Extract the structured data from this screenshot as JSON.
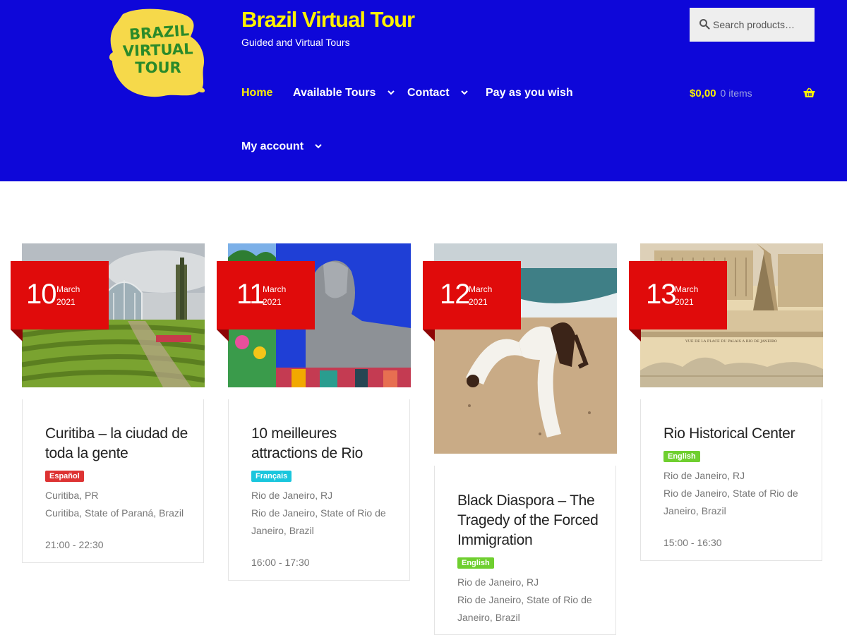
{
  "site": {
    "title": "Brazil Virtual Tour",
    "tagline": "Guided and Virtual Tours",
    "logo_text": "BRAZIL VIRTUAL TOUR"
  },
  "search": {
    "placeholder": "Search products…"
  },
  "nav": {
    "items": [
      {
        "label": "Home",
        "active": true
      },
      {
        "label": "Available Tours",
        "dropdown": true
      },
      {
        "label": "Contact",
        "dropdown": true
      },
      {
        "label": "Pay as you wish"
      },
      {
        "label": "My account",
        "dropdown": true
      }
    ]
  },
  "cart": {
    "total": "$0,00",
    "count": "0 items"
  },
  "colors": {
    "header_bg": "#0e07d9",
    "accent_yellow": "#fdf100",
    "date_red": "#e00b0b",
    "tag_spanish": "#dd3333",
    "tag_french": "#1ac6dd",
    "tag_english": "#6fcf2f"
  },
  "events": [
    {
      "day": "10",
      "month": "March",
      "year": "2021",
      "title": "Curitiba – la ciudad de toda la gente",
      "language": "Español",
      "location_short": "Curitiba, PR",
      "location_full": "Curitiba, State of Paraná, Brazil",
      "time": "21:00 - 22:30"
    },
    {
      "day": "11",
      "month": "March",
      "year": "2021",
      "title": "10 meilleures attractions de Rio",
      "language": "Français",
      "location_short": "Rio de Janeiro, RJ",
      "location_full": "Rio de Janeiro, State of Rio de Janeiro, Brazil",
      "time": "16:00 - 17:30"
    },
    {
      "day": "12",
      "month": "March",
      "year": "2021",
      "title": "Black Diaspora – The Tragedy of the Forced Immigration",
      "language": "English",
      "location_short": "Rio de Janeiro, RJ",
      "location_full": "Rio de Janeiro, State of Rio de Janeiro, Brazil",
      "time": ""
    },
    {
      "day": "13",
      "month": "March",
      "year": "2021",
      "title": "Rio Historical Center",
      "language": "English",
      "location_short": "Rio de Janeiro, RJ",
      "location_full": "Rio de Janeiro, State of Rio de Janeiro, Brazil",
      "time": "15:00 - 16:30"
    }
  ]
}
